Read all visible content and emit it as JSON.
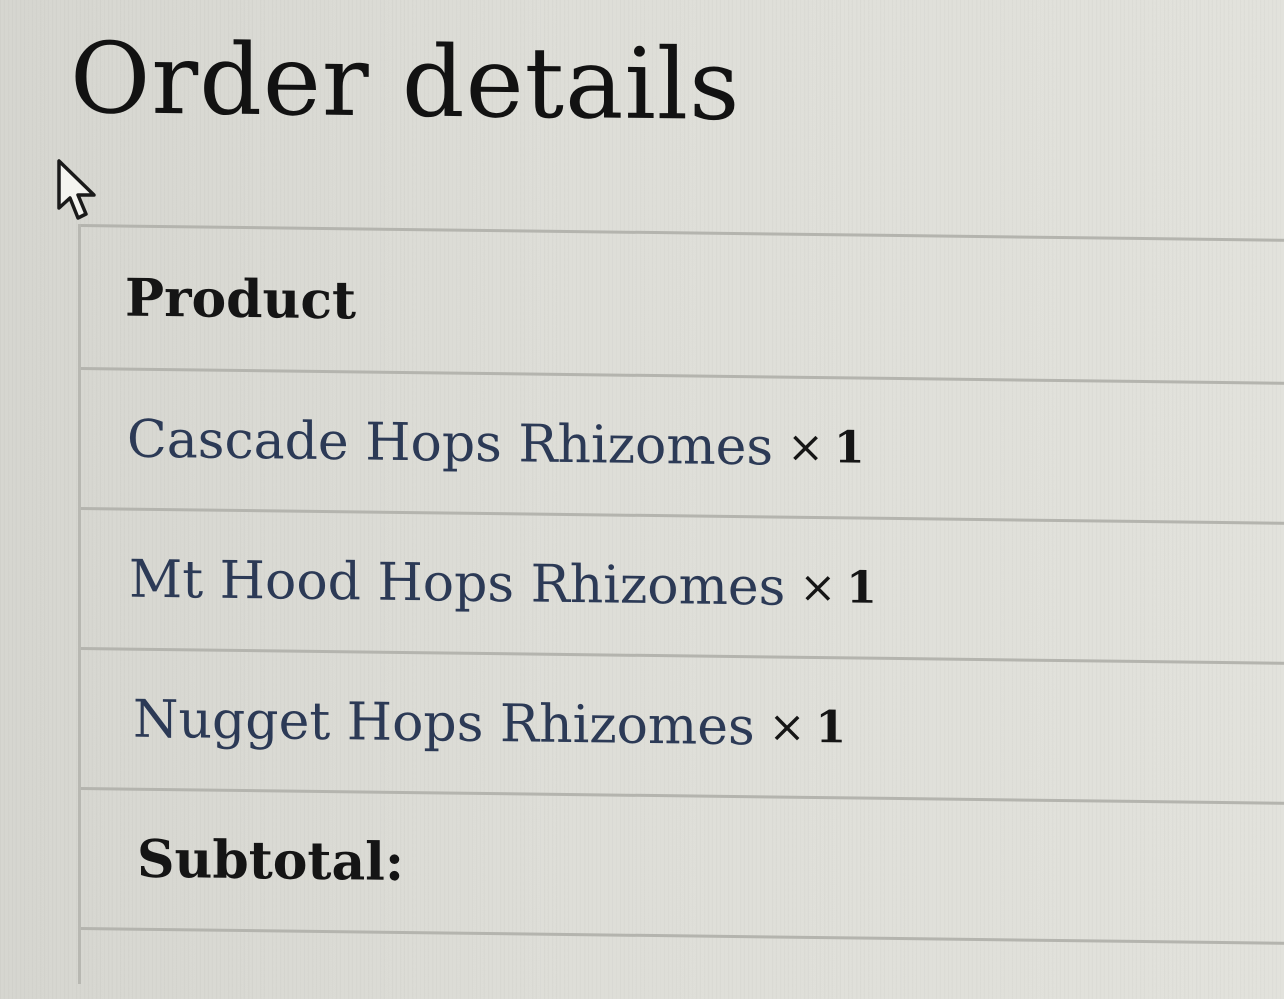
{
  "page": {
    "title": "Order details"
  },
  "table": {
    "header": "Product",
    "items": [
      {
        "name": "Cascade Hops Rhizomes",
        "times": "×",
        "qty": "1"
      },
      {
        "name": "Mt Hood Hops Rhizomes",
        "times": "×",
        "qty": "1"
      },
      {
        "name": "Nugget Hops Rhizomes",
        "times": "×",
        "qty": "1"
      }
    ],
    "subtotal_label": "Subtotal:"
  },
  "icons": {
    "cursor": "mouse-pointer-icon"
  },
  "colors": {
    "link": "#2c3a56",
    "text": "#151515",
    "background": "#dcdcd6",
    "border": "#b4b4ae"
  }
}
